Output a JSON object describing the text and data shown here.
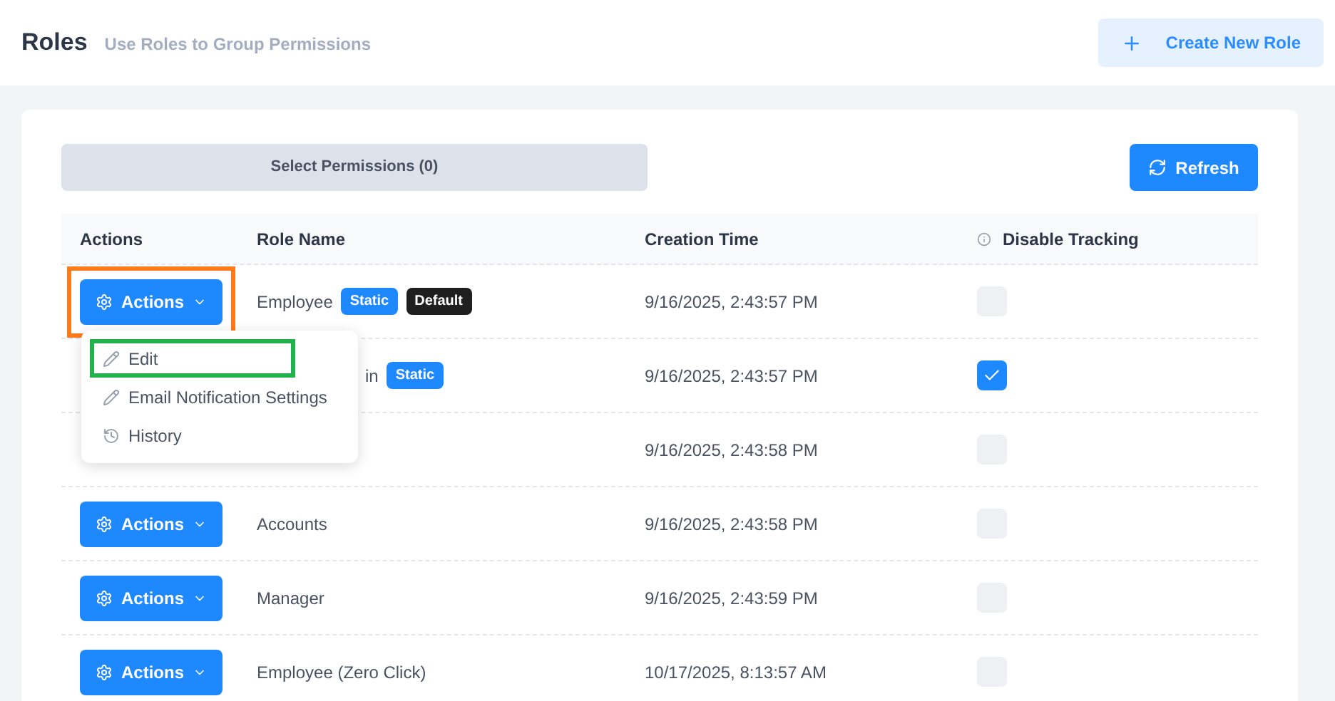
{
  "header": {
    "title": "Roles",
    "subtitle": "Use Roles to Group Permissions",
    "create_button": "Create New Role"
  },
  "toolbar": {
    "select_permissions": "Select Permissions (0)",
    "refresh": "Refresh"
  },
  "table": {
    "columns": [
      "Actions",
      "Role Name",
      "Creation Time",
      "Disable Tracking"
    ],
    "rows": [
      {
        "kind": "full",
        "actions": "Actions",
        "highlighted": true,
        "name": "Employee",
        "tags": [
          {
            "label": "Static",
            "kind": "static"
          },
          {
            "label": "Default",
            "kind": "default"
          }
        ],
        "time": "9/16/2025, 2:43:57 PM",
        "checked": false
      },
      {
        "kind": "covered",
        "name": "in",
        "tags": [
          {
            "label": "Static",
            "kind": "static"
          }
        ],
        "time": "9/16/2025, 2:43:57 PM",
        "checked": true
      },
      {
        "kind": "covered",
        "time": "9/16/2025, 2:43:58 PM",
        "checked": false
      },
      {
        "kind": "full",
        "actions": "Actions",
        "highlighted": false,
        "name": "Accounts",
        "time": "9/16/2025, 2:43:58 PM",
        "checked": false
      },
      {
        "kind": "full",
        "actions": "Actions",
        "highlighted": false,
        "name": "Manager",
        "time": "9/16/2025, 2:43:59 PM",
        "checked": false
      },
      {
        "kind": "full",
        "actions": "Actions",
        "highlighted": false,
        "name": "Employee (Zero Click)",
        "time": "10/17/2025, 8:13:57 AM",
        "checked": false
      }
    ]
  },
  "menu": {
    "items": [
      {
        "label": "Edit",
        "kind": "edit",
        "highlighted": true
      },
      {
        "label": "Email Notification Settings",
        "kind": "edit",
        "highlighted": false
      },
      {
        "label": "History",
        "kind": "history",
        "highlighted": false
      }
    ]
  }
}
